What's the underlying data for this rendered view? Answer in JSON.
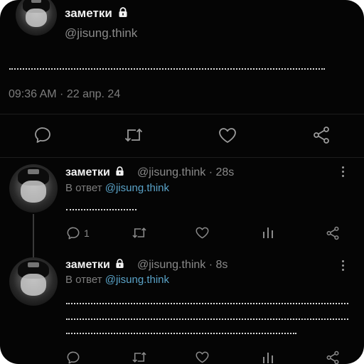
{
  "main_tweet": {
    "display_name": "заметки",
    "handle": "@jisung.think",
    "timestamp": "09:36 AM · 22 апр. 24"
  },
  "replies": [
    {
      "display_name": "заметки",
      "handle_meta": "@jisung.think · 28s",
      "reply_prefix": "В ответ",
      "reply_mention": "@jisung.think",
      "comment_count": "1"
    },
    {
      "display_name": "заметки",
      "handle_meta": "@jisung.think · 8s",
      "reply_prefix": "В ответ",
      "reply_mention": "@jisung.think",
      "comment_count": ""
    }
  ],
  "icons": {
    "lock": "lock-icon",
    "reply": "comment-icon",
    "retweet": "retweet-icon",
    "like": "heart-icon",
    "views": "views-icon",
    "share": "share-icon",
    "more": "more-vertical-icon"
  },
  "colors": {
    "background": "#050505",
    "mention": "#5aa3c8",
    "muted_text": "#7d7d7d"
  }
}
